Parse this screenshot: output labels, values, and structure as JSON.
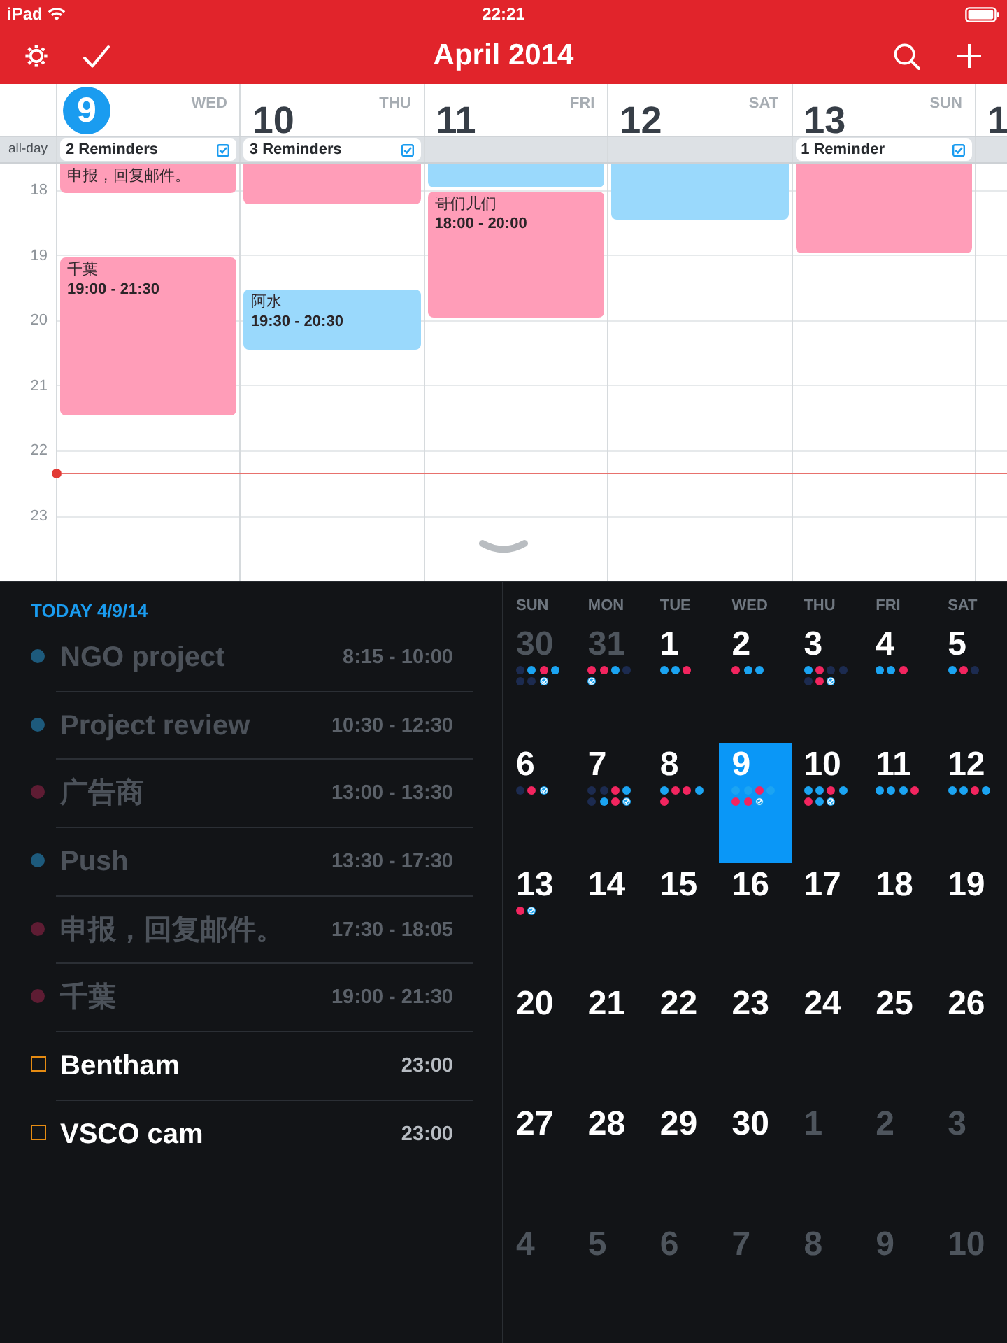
{
  "status_bar": {
    "device": "iPad",
    "time": "22:21"
  },
  "nav_bar": {
    "title": "April 2014"
  },
  "week_view": {
    "all_day_label": "all-day",
    "hours": [
      "18",
      "19",
      "20",
      "21",
      "22",
      "23"
    ],
    "days": [
      {
        "number": "9",
        "weekday": "WED",
        "today": true,
        "reminders": "2 Reminders",
        "events": [
          {
            "title": "申报，回复邮件。",
            "color": "#ff9db8"
          },
          {
            "title": "千葉",
            "time": "19:00 - 21:30",
            "color": "#ff9db8"
          }
        ]
      },
      {
        "number": "10",
        "weekday": "THU",
        "today": false,
        "reminders": "3 Reminders",
        "events": [
          {
            "color": "#ff9db8"
          },
          {
            "title": "阿水",
            "time": "19:30 - 20:30",
            "color": "#9ad9fc"
          }
        ]
      },
      {
        "number": "11",
        "weekday": "FRI",
        "today": false,
        "events": [
          {
            "color": "#9ad9fc"
          },
          {
            "title": "哥们儿们",
            "time": "18:00 - 20:00",
            "color": "#ff9db8"
          }
        ]
      },
      {
        "number": "12",
        "weekday": "SAT",
        "today": false,
        "events": [
          {
            "color": "#9ad9fc"
          }
        ]
      },
      {
        "number": "13",
        "weekday": "SUN",
        "today": false,
        "reminders": "1 Reminder",
        "events": [
          {
            "color": "#ff9db8"
          }
        ]
      },
      {
        "number": "1",
        "today": false
      }
    ]
  },
  "today_list": {
    "heading": "TODAY 4/9/14",
    "items": [
      {
        "kind": "event",
        "title": "NGO project",
        "time": "8:15 - 10:00",
        "color": "#1d5a7c"
      },
      {
        "kind": "event",
        "title": "Project review",
        "time": "10:30 - 12:30",
        "color": "#1d5a7c"
      },
      {
        "kind": "event",
        "title": "广告商",
        "time": "13:00 - 13:30",
        "color": "#5e1c33"
      },
      {
        "kind": "event",
        "title": "Push",
        "time": "13:30 - 17:30",
        "color": "#1d5a7c"
      },
      {
        "kind": "event",
        "title": "申报，回复邮件。",
        "time": "17:30 - 18:05",
        "color": "#5e1c33"
      },
      {
        "kind": "event",
        "title": "千葉",
        "time": "19:00 - 21:30",
        "color": "#5e1c33"
      },
      {
        "kind": "reminder",
        "title": "Bentham",
        "time": "23:00",
        "checked": false
      },
      {
        "kind": "reminder",
        "title": "VSCO cam",
        "time": "23:00",
        "checked": false
      }
    ]
  },
  "month_calendar": {
    "weekdays": [
      "SUN",
      "MON",
      "TUE",
      "WED",
      "THU",
      "FRI",
      "SAT"
    ],
    "weeks": [
      {
        "days": [
          {
            "day": "30",
            "other_month": true,
            "selected": false,
            "dots": [
              {
                "kind": "event",
                "color": "#1c2b50"
              },
              {
                "kind": "event",
                "color": "#1ba4f2"
              },
              {
                "kind": "event",
                "color": "#f2255f"
              },
              {
                "kind": "event",
                "color": "#1ba4f2"
              },
              {
                "kind": "event",
                "color": "#1c2b50"
              },
              {
                "kind": "event",
                "color": "#1c2b50"
              },
              {
                "kind": "reminder"
              }
            ]
          },
          {
            "day": "31",
            "other_month": true,
            "selected": false,
            "dots": [
              {
                "kind": "event",
                "color": "#f2255f"
              },
              {
                "kind": "event",
                "color": "#f2255f"
              },
              {
                "kind": "event",
                "color": "#1ba4f2"
              },
              {
                "kind": "event",
                "color": "#1c2b50"
              },
              {
                "kind": "reminder"
              }
            ]
          },
          {
            "day": "1",
            "other_month": false,
            "selected": false,
            "dots": [
              {
                "kind": "event",
                "color": "#1ba4f2"
              },
              {
                "kind": "event",
                "color": "#1ba4f2"
              },
              {
                "kind": "event",
                "color": "#f2255f"
              }
            ]
          },
          {
            "day": "2",
            "other_month": false,
            "selected": false,
            "dots": [
              {
                "kind": "event",
                "color": "#f2255f"
              },
              {
                "kind": "event",
                "color": "#1ba4f2"
              },
              {
                "kind": "event",
                "color": "#1ba4f2"
              }
            ]
          },
          {
            "day": "3",
            "other_month": false,
            "selected": false,
            "dots": [
              {
                "kind": "event",
                "color": "#1ba4f2"
              },
              {
                "kind": "event",
                "color": "#f2255f"
              },
              {
                "kind": "event",
                "color": "#1c2b50"
              },
              {
                "kind": "event",
                "color": "#1c2b50"
              },
              {
                "kind": "event",
                "color": "#1c2b50"
              },
              {
                "kind": "event",
                "color": "#f2255f"
              },
              {
                "kind": "reminder"
              }
            ]
          },
          {
            "day": "4",
            "other_month": false,
            "selected": false,
            "dots": [
              {
                "kind": "event",
                "color": "#1ba4f2"
              },
              {
                "kind": "event",
                "color": "#1ba4f2"
              },
              {
                "kind": "event",
                "color": "#f2255f"
              }
            ]
          },
          {
            "day": "5",
            "other_month": false,
            "selected": false,
            "dots": [
              {
                "kind": "event",
                "color": "#1ba4f2"
              },
              {
                "kind": "event",
                "color": "#f2255f"
              },
              {
                "kind": "event",
                "color": "#1c2b50"
              }
            ]
          }
        ]
      },
      {
        "days": [
          {
            "day": "6",
            "other_month": false,
            "selected": false,
            "dots": [
              {
                "kind": "event",
                "color": "#1c2b50"
              },
              {
                "kind": "event",
                "color": "#f2255f"
              },
              {
                "kind": "reminder"
              }
            ]
          },
          {
            "day": "7",
            "other_month": false,
            "selected": false,
            "dots": [
              {
                "kind": "event",
                "color": "#1c2b50"
              },
              {
                "kind": "event",
                "color": "#1c2b50"
              },
              {
                "kind": "event",
                "color": "#f2255f"
              },
              {
                "kind": "event",
                "color": "#1ba4f2"
              },
              {
                "kind": "event",
                "color": "#1c2b50"
              },
              {
                "kind": "event",
                "color": "#1ba4f2"
              },
              {
                "kind": "event",
                "color": "#f2255f"
              },
              {
                "kind": "reminder"
              }
            ]
          },
          {
            "day": "8",
            "other_month": false,
            "selected": false,
            "dots": [
              {
                "kind": "event",
                "color": "#1ba4f2"
              },
              {
                "kind": "event",
                "color": "#f2255f"
              },
              {
                "kind": "event",
                "color": "#f2255f"
              },
              {
                "kind": "event",
                "color": "#1ba4f2"
              },
              {
                "kind": "event",
                "color": "#f2255f"
              }
            ]
          },
          {
            "day": "9",
            "other_month": false,
            "selected": true,
            "dots": [
              {
                "kind": "event",
                "color": "#1ba4f2"
              },
              {
                "kind": "event",
                "color": "#1ba4f2"
              },
              {
                "kind": "event",
                "color": "#f2255f"
              },
              {
                "kind": "event",
                "color": "#1ba4f2"
              },
              {
                "kind": "event",
                "color": "#f2255f"
              },
              {
                "kind": "event",
                "color": "#f2255f"
              },
              {
                "kind": "reminder"
              }
            ]
          },
          {
            "day": "10",
            "other_month": false,
            "selected": false,
            "dots": [
              {
                "kind": "event",
                "color": "#1ba4f2"
              },
              {
                "kind": "event",
                "color": "#1ba4f2"
              },
              {
                "kind": "event",
                "color": "#f2255f"
              },
              {
                "kind": "event",
                "color": "#1ba4f2"
              },
              {
                "kind": "event",
                "color": "#f2255f"
              },
              {
                "kind": "event",
                "color": "#1ba4f2"
              },
              {
                "kind": "reminder"
              }
            ]
          },
          {
            "day": "11",
            "other_month": false,
            "selected": false,
            "dots": [
              {
                "kind": "event",
                "color": "#1ba4f2"
              },
              {
                "kind": "event",
                "color": "#1ba4f2"
              },
              {
                "kind": "event",
                "color": "#1ba4f2"
              },
              {
                "kind": "event",
                "color": "#f2255f"
              }
            ]
          },
          {
            "day": "12",
            "other_month": false,
            "selected": false,
            "dots": [
              {
                "kind": "event",
                "color": "#1ba4f2"
              },
              {
                "kind": "event",
                "color": "#1ba4f2"
              },
              {
                "kind": "event",
                "color": "#f2255f"
              },
              {
                "kind": "event",
                "color": "#1ba4f2"
              }
            ]
          }
        ]
      },
      {
        "days": [
          {
            "day": "13",
            "other_month": false,
            "selected": false,
            "dots": [
              {
                "kind": "event",
                "color": "#f2255f"
              },
              {
                "kind": "reminder"
              }
            ]
          },
          {
            "day": "14",
            "other_month": false,
            "selected": false
          },
          {
            "day": "15",
            "other_month": false,
            "selected": false
          },
          {
            "day": "16",
            "other_month": false,
            "selected": false
          },
          {
            "day": "17",
            "other_month": false,
            "selected": false
          },
          {
            "day": "18",
            "other_month": false,
            "selected": false
          },
          {
            "day": "19",
            "other_month": false,
            "selected": false
          }
        ]
      },
      {
        "days": [
          {
            "day": "20",
            "other_month": false,
            "selected": false
          },
          {
            "day": "21",
            "other_month": false,
            "selected": false
          },
          {
            "day": "22",
            "other_month": false,
            "selected": false
          },
          {
            "day": "23",
            "other_month": false,
            "selected": false
          },
          {
            "day": "24",
            "other_month": false,
            "selected": false
          },
          {
            "day": "25",
            "other_month": false,
            "selected": false
          },
          {
            "day": "26",
            "other_month": false,
            "selected": false
          }
        ]
      },
      {
        "days": [
          {
            "day": "27",
            "other_month": false,
            "selected": false
          },
          {
            "day": "28",
            "other_month": false,
            "selected": false
          },
          {
            "day": "29",
            "other_month": false,
            "selected": false
          },
          {
            "day": "30",
            "other_month": false,
            "selected": false
          },
          {
            "day": "1",
            "other_month": true,
            "selected": false
          },
          {
            "day": "2",
            "other_month": true,
            "selected": false
          },
          {
            "day": "3",
            "other_month": true,
            "selected": false
          }
        ]
      },
      {
        "days": [
          {
            "day": "4",
            "other_month": true,
            "selected": false
          },
          {
            "day": "5",
            "other_month": true,
            "selected": false
          },
          {
            "day": "6",
            "other_month": true,
            "selected": false
          },
          {
            "day": "7",
            "other_month": true,
            "selected": false
          },
          {
            "day": "8",
            "other_month": true,
            "selected": false
          },
          {
            "day": "9",
            "other_month": true,
            "selected": false
          },
          {
            "day": "10",
            "other_month": true,
            "selected": false
          }
        ]
      }
    ]
  }
}
